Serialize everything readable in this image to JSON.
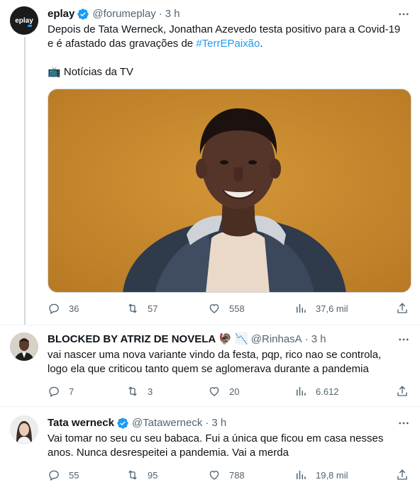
{
  "tweets": [
    {
      "name": "eplay",
      "verified": true,
      "handle": "@forumeplay",
      "time": "3 h",
      "avatar_text": "eplay",
      "text_lines": [
        "Depois de Tata Werneck, Jonathan Azevedo testa positivo para a Covid-19",
        "e é afastado das gravações de "
      ],
      "hashtag": "#TerrEPaixão",
      "text_tail": ".",
      "source_emoji": "📺",
      "source_label": "Notícias da TV",
      "replies": "36",
      "retweets": "57",
      "likes": "558",
      "views": "37,6 mil"
    },
    {
      "name": "BLOCKED BY ATRIZ DE NOVELA",
      "name_emojis": "🦃 📉",
      "handle": "@RinhasA",
      "time": "3 h",
      "text_lines": [
        "vai nascer uma nova variante vindo da festa, pqp, rico nao se controla,",
        "logo ela que criticou tanto quem se aglomerava durante a pandemia"
      ],
      "replies": "7",
      "retweets": "3",
      "likes": "20",
      "views": "6.612"
    },
    {
      "name": "Tata werneck",
      "verified": true,
      "handle": "@Tatawerneck",
      "time": "3 h",
      "text_lines": [
        "Vai tomar no seu cu seu babaca. Fui a única que ficou em casa nesses",
        "anos. Nunca desrespeitei a pandemia. Vai a merda"
      ],
      "replies": "55",
      "retweets": "95",
      "likes": "788",
      "views": "19,8 mil"
    }
  ],
  "colors": {
    "verified_blue": "#1d9bf0",
    "secondary_text": "#536471",
    "hashtag": "#1d9bf0",
    "thread_line": "#cfd9de",
    "media_background": "#c98a2e"
  },
  "icons": {
    "more": "more-horizontal-icon",
    "reply": "reply-icon",
    "retweet": "retweet-icon",
    "like": "heart-icon",
    "views": "views-chart-icon",
    "share": "share-icon",
    "verified": "verified-badge-icon"
  }
}
